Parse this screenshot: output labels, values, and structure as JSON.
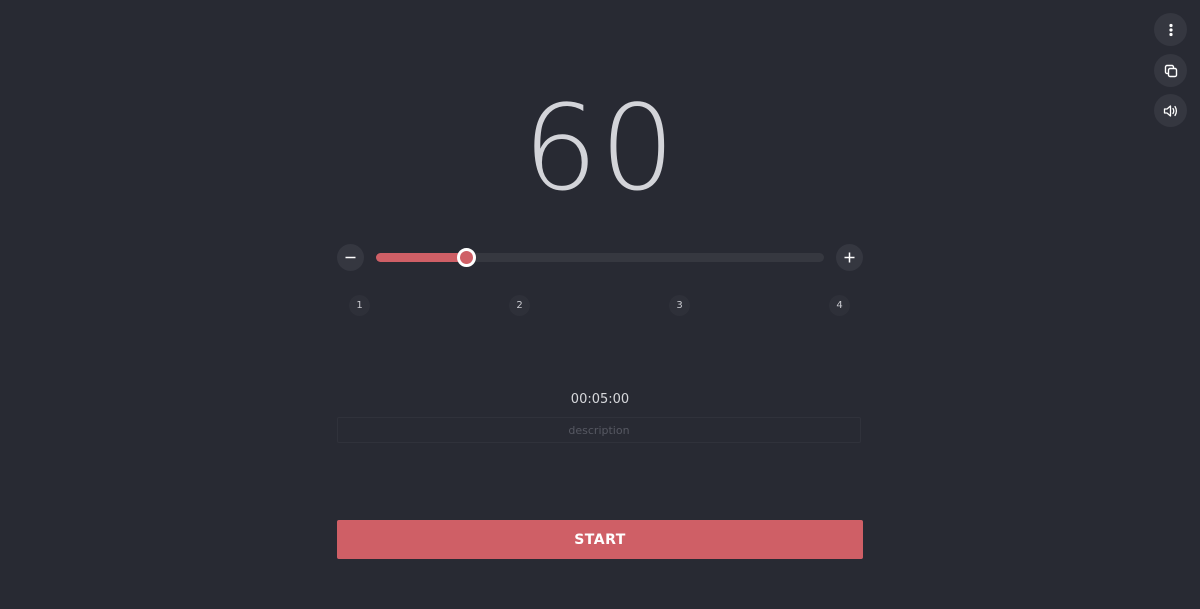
{
  "controls": {
    "menu_icon": "vertical-dots-icon",
    "copy_icon": "copy-icon",
    "sound_icon": "speaker-icon"
  },
  "tempo": {
    "value": "60",
    "slider_fraction": 0.2
  },
  "stepper": {
    "minus_icon": "minus-icon",
    "plus_icon": "plus-icon"
  },
  "beats": [
    "1",
    "2",
    "3",
    "4"
  ],
  "timer": "00:05:00",
  "description": {
    "value": "",
    "placeholder": "description"
  },
  "start_label": "START",
  "colors": {
    "background": "#282a33",
    "accent": "#cf5f66",
    "button_bg": "#353740",
    "text": "#d3d4d9"
  }
}
